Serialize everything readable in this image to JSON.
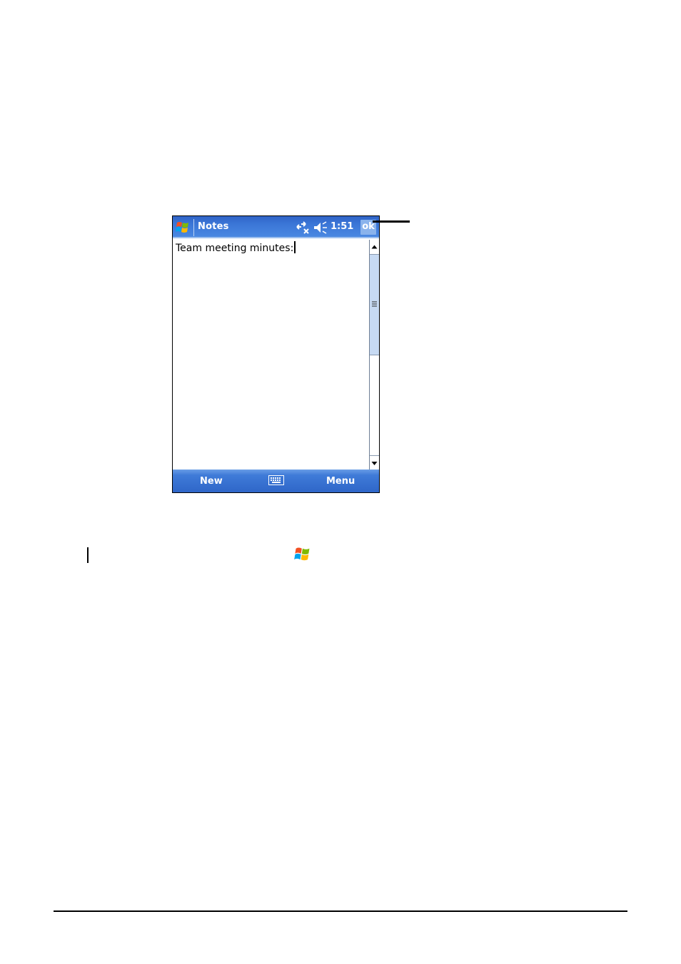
{
  "device": {
    "title": "Notes",
    "clock": "1:51",
    "ok_label": "ok",
    "note_text": "Team meeting minutes:",
    "softkeys": {
      "left": "New",
      "right": "Menu"
    }
  },
  "icons": {
    "start": "windows-flag-icon",
    "connectivity": "connectivity-icon",
    "volume": "volume-icon",
    "keyboard": "keyboard-icon"
  },
  "colors": {
    "titlebar": "#3a75d6",
    "menubar": "#2f66c8",
    "ok_button": "#8ab3ec",
    "scroll_thumb": "#c7daf3"
  }
}
